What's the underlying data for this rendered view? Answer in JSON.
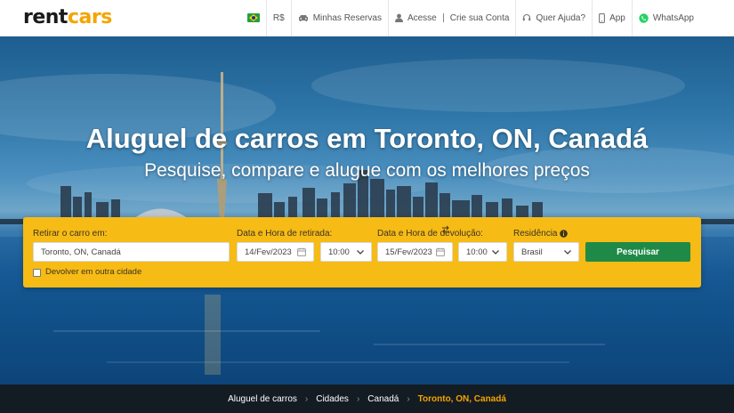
{
  "brand": {
    "logo_left": "rent",
    "logo_right": "cars",
    "accent_color": "#f5a400"
  },
  "nav": {
    "flag_icon": "brazil-flag-icon",
    "currency": "R$",
    "reservations": "Minhas Reservas",
    "login": "Acesse",
    "signup": "Crie sua Conta",
    "help": "Quer Ajuda?",
    "app": "App",
    "whatsapp": "WhatsApp"
  },
  "hero": {
    "title": "Aluguel de carros em Toronto, ON, Canadá",
    "subtitle": "Pesquise, compare e alugue com os melhores preços"
  },
  "search": {
    "pickup_label": "Retirar o carro em:",
    "pickup_value": "Toronto, ON, Canadá",
    "pickup_datetime_label": "Data e Hora de retirada:",
    "pickup_date": "14/Fev/2023",
    "pickup_time": "10:00",
    "return_datetime_label": "Data e Hora de devolução:",
    "return_date": "15/Fev/2023",
    "return_time": "10:00",
    "residence_label": "Residência",
    "residence_value": "Brasil",
    "other_city_label": "Devolver em outra cidade",
    "submit_label": "Pesquisar",
    "button_color": "#1f8a47",
    "panel_color": "#f7bb16"
  },
  "breadcrumb": {
    "items": [
      "Aluguel de carros",
      "Cidades",
      "Canadá"
    ],
    "current": "Toronto, ON, Canadá"
  }
}
